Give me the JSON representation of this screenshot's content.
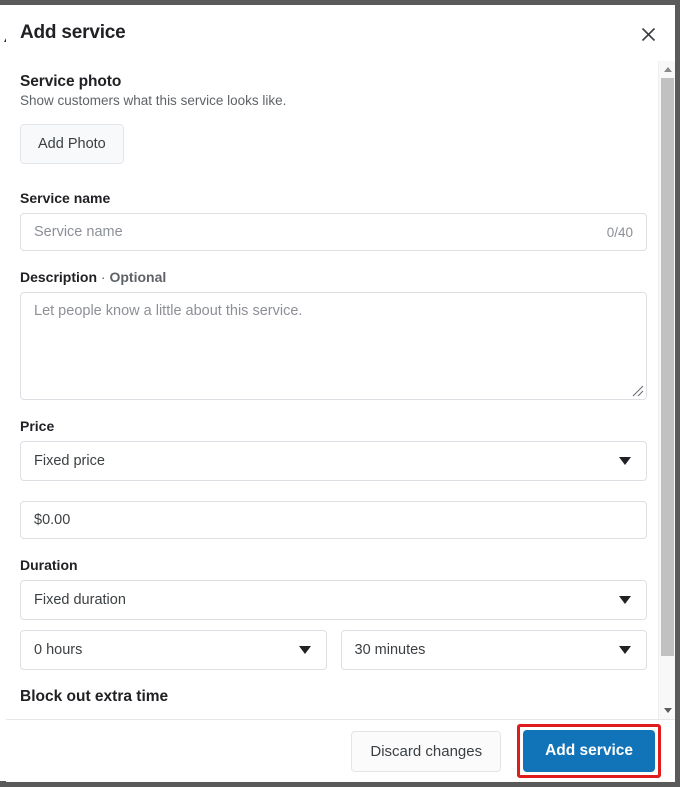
{
  "dialog": {
    "title": "Add service",
    "close_icon": "close-icon"
  },
  "photo_section": {
    "heading": "Service photo",
    "subtext": "Show customers what this service looks like.",
    "button_label": "Add Photo"
  },
  "service_name": {
    "label": "Service name",
    "placeholder": "Service name",
    "value": "",
    "counter": "0/40"
  },
  "description": {
    "label": "Description",
    "separator": "·",
    "optional_label": "Optional",
    "placeholder": "Let people know a little about this service.",
    "value": ""
  },
  "price": {
    "label": "Price",
    "type_value": "Fixed price",
    "amount_value": "$0.00"
  },
  "duration": {
    "label": "Duration",
    "type_value": "Fixed duration",
    "hours_value": "0 hours",
    "minutes_value": "30 minutes"
  },
  "next_section": {
    "heading": "Block out extra time"
  },
  "footer": {
    "discard_label": "Discard changes",
    "submit_label": "Add service",
    "submit_color": "#1274b8",
    "highlight_color": "#e01b1b"
  },
  "scrollbar": {
    "up_arrow_icon": "caret-up-icon",
    "down_arrow_icon": "caret-down-icon"
  },
  "background": {
    "left_glyph": "▲"
  }
}
